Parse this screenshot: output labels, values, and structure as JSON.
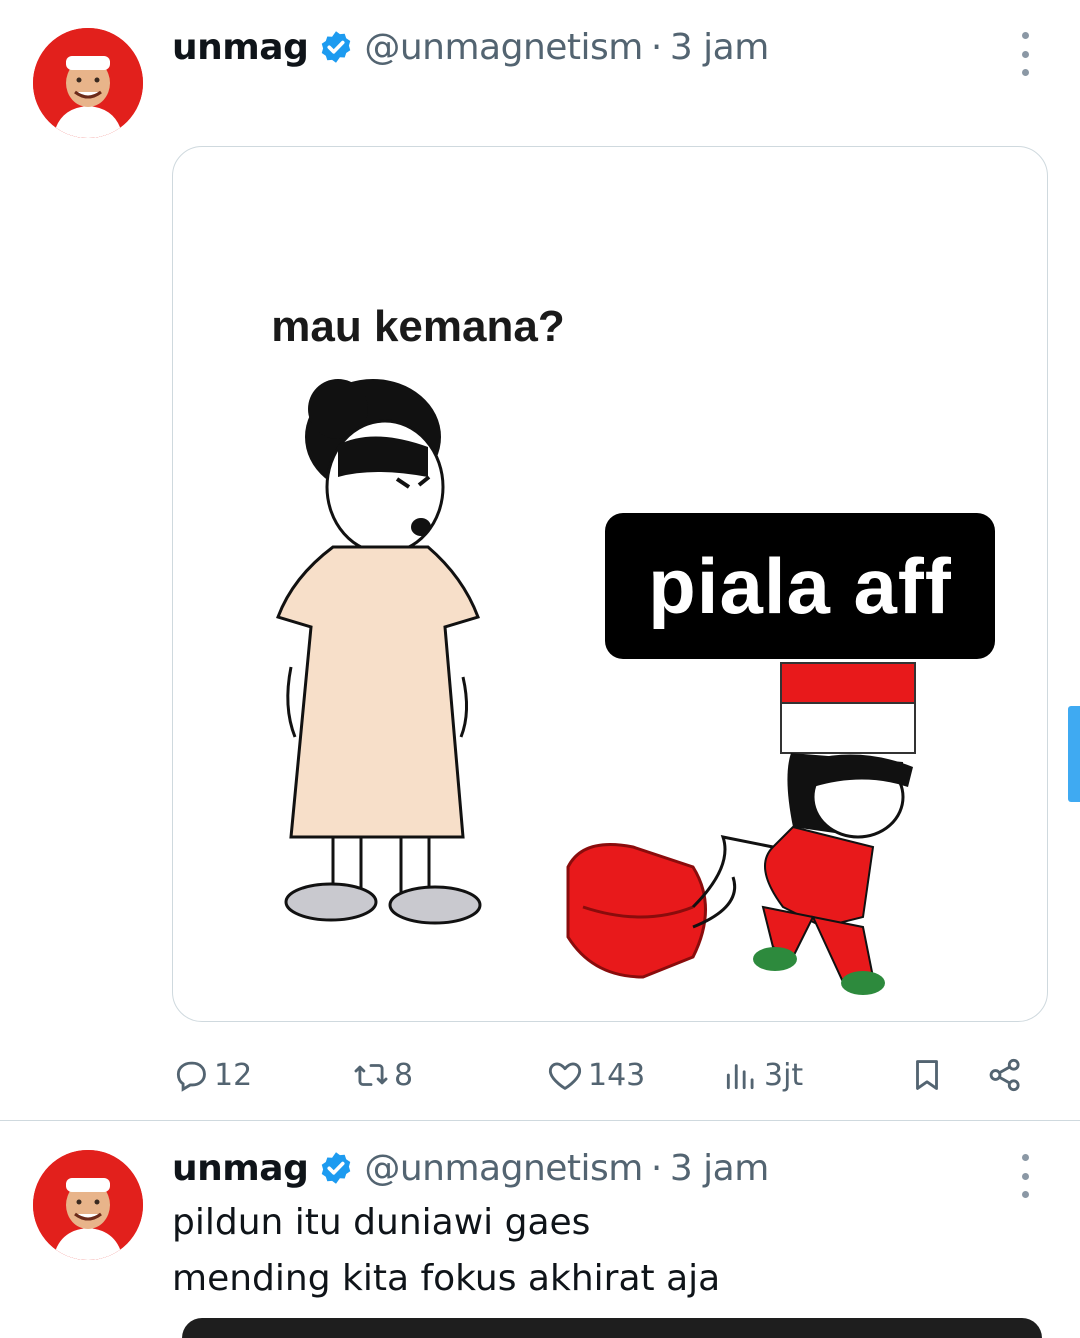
{
  "tweets": [
    {
      "name": "unmag",
      "handle": "@unmagnetism",
      "separator": "·",
      "time": "3 jam",
      "media": {
        "caption_question": "mau kemana?",
        "caption_label": "piala aff"
      },
      "actions": {
        "replies": "12",
        "retweets": "8",
        "likes": "143",
        "views": "3jt"
      }
    },
    {
      "name": "unmag",
      "handle": "@unmagnetism",
      "separator": "·",
      "time": "3 jam",
      "text_lines": [
        "pildun itu duniawi gaes",
        "mending kita fokus akhirat aja"
      ]
    }
  ],
  "colors": {
    "verified": "#1d9bf0",
    "secondary_text": "#536471",
    "divider": "#cfd9de",
    "flag_red": "#e8191b"
  },
  "icons": [
    "verified-badge-icon",
    "more-icon",
    "reply-icon",
    "retweet-icon",
    "like-icon",
    "views-icon",
    "bookmark-icon",
    "share-icon"
  ]
}
